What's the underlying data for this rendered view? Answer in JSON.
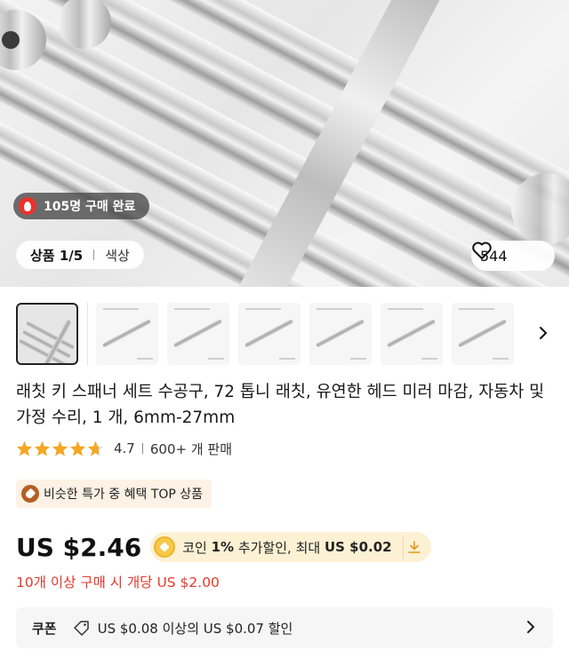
{
  "hero": {
    "sold_badge": "105명 구매 완료",
    "counter": "상품 1/5",
    "color_label": "색상",
    "wishlist_count": "544"
  },
  "thumbnails": {
    "count": 7,
    "active_index": 0,
    "next_icon": "chevron-right-icon"
  },
  "product": {
    "title": "래칫 키 스패너 세트 수공구, 72 톱니 래칫, 유연한 헤드 미러 마감, 자동차 및 가정 수리, 1 개, 6mm-27mm",
    "rating": "4.7",
    "rating_value": 4.7,
    "sold": "600+ 개 판매"
  },
  "promo": {
    "badge": "비슷한 특가 중 혜택 TOP 상품"
  },
  "price": {
    "amount": "US $2.46",
    "coin_text_prefix": "코인 ",
    "coin_percent": "1%",
    "coin_text_mid": " 추가할인, 최대 ",
    "coin_max": "US $0.02"
  },
  "bulk_offer": "10개 이상 구매 시 개당 US $2.00",
  "coupon": {
    "label": "쿠폰",
    "text": "US $0.08 이상의 US $0.07 할인"
  },
  "colors": {
    "accent_red": "#e8392b",
    "promo_bg": "#fdf2e5",
    "coin_bg": "#fdf1d4",
    "star": "#f5a623"
  }
}
